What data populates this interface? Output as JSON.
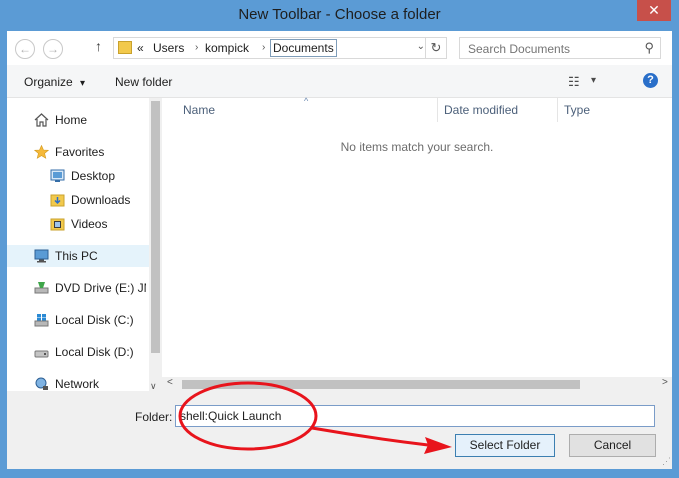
{
  "window": {
    "title": "New Toolbar - Choose a folder",
    "close_glyph": "✕"
  },
  "navbar": {
    "back_glyph": "←",
    "forward_glyph": "→",
    "up_glyph": "↑",
    "breadcrumb": {
      "overflow": "«",
      "items": [
        "Users",
        "kompick",
        "Documents"
      ],
      "separator": "›"
    },
    "dropdown_glyph": "⌄",
    "refresh_glyph": "↻",
    "search_placeholder": "Search Documents",
    "search_glyph": "⚲"
  },
  "commandbar": {
    "organize_label": "Organize",
    "organize_caret": "▾",
    "new_folder_label": "New folder",
    "view_glyph": "☷",
    "view_caret": "▾",
    "help_glyph": "?"
  },
  "nav_pane": {
    "items": [
      {
        "label": "Home",
        "icon": "home-icon"
      },
      {
        "label": "Favorites",
        "icon": "star-icon"
      },
      {
        "label": "Desktop",
        "icon": "desktop-icon"
      },
      {
        "label": "Downloads",
        "icon": "downloads-icon"
      },
      {
        "label": "Videos",
        "icon": "videos-icon"
      },
      {
        "label": "This PC",
        "icon": "computer-icon"
      },
      {
        "label": "DVD Drive (E:) JM",
        "icon": "dvd-drive-icon"
      },
      {
        "label": "Local Disk (C:)",
        "icon": "disk-icon"
      },
      {
        "label": "Local Disk (D:)",
        "icon": "disk-icon"
      },
      {
        "label": "Network",
        "icon": "network-icon"
      }
    ],
    "selected": "This PC"
  },
  "file_list": {
    "columns": [
      "Name",
      "Date modified",
      "Type"
    ],
    "empty_message": "No items match your search."
  },
  "footer": {
    "folder_label": "Folder:",
    "folder_value": "shell:Quick Launch",
    "select_button": "Select Folder",
    "cancel_button": "Cancel"
  },
  "colors": {
    "title_bar": "#5b9bd5",
    "close_button": "#c7504a",
    "annotation": "#e8141c",
    "selection": "#e5f3fb"
  }
}
